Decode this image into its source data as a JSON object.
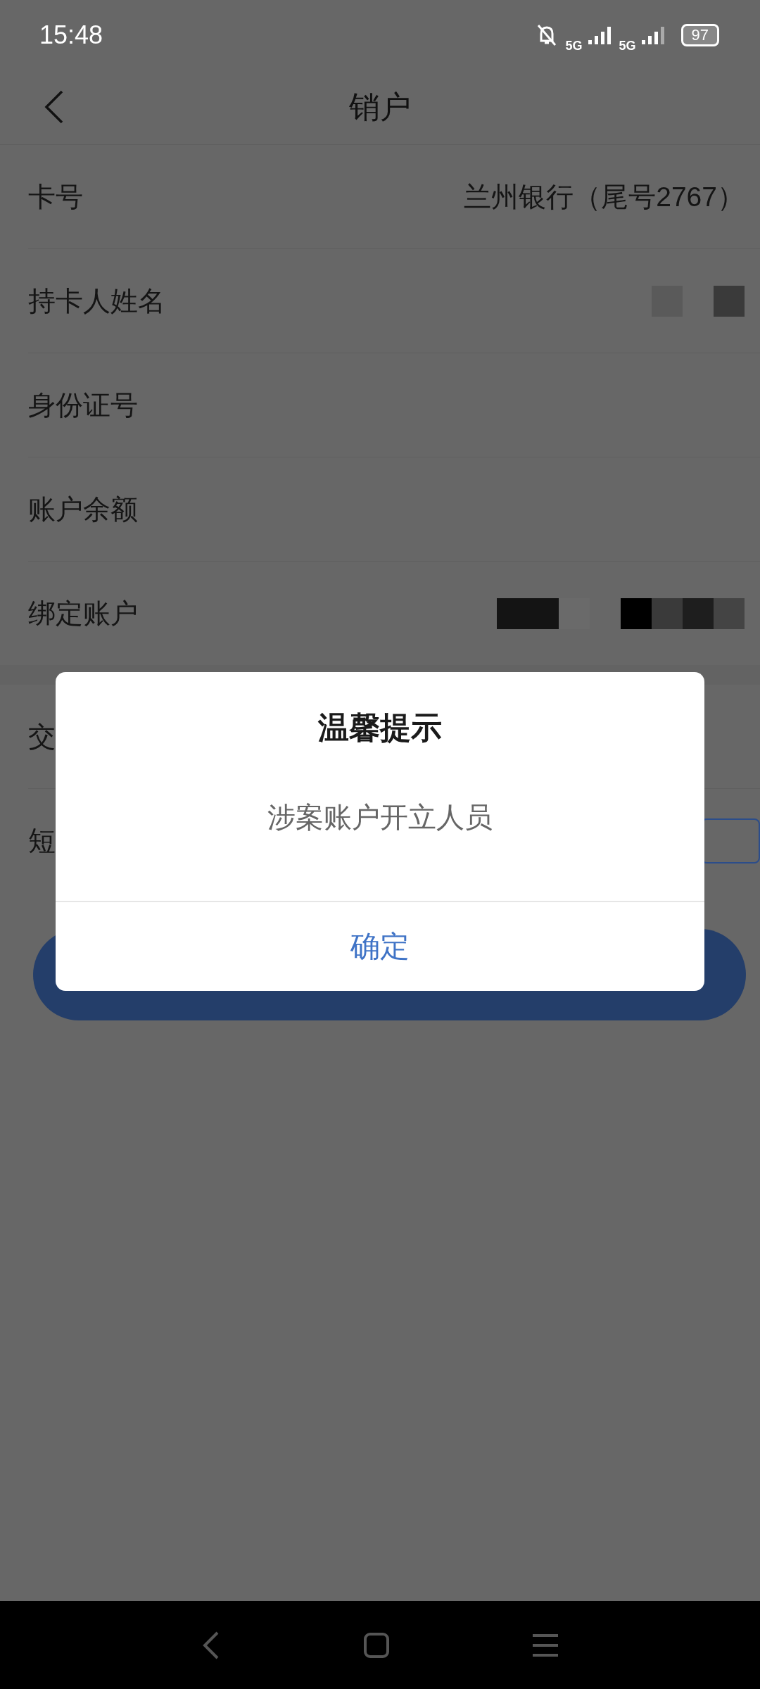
{
  "status_bar": {
    "time": "15:48",
    "battery": "97",
    "network_1": "5G",
    "network_2": "5G"
  },
  "header": {
    "title": "销户"
  },
  "rows": [
    {
      "label": "卡号",
      "value": "兰州银行（尾号2767）",
      "kind": "text"
    },
    {
      "label": "持卡人姓名",
      "kind": "mosaic"
    },
    {
      "label": "身份证号",
      "kind": "empty"
    },
    {
      "label": "账户余额",
      "kind": "empty"
    },
    {
      "label": "绑定账户",
      "kind": "mosaic"
    }
  ],
  "rows_2": [
    {
      "label": "交",
      "kind": "empty"
    },
    {
      "label": "短",
      "kind": "input"
    }
  ],
  "dialog": {
    "title": "温馨提示",
    "message": "涉案账户开立人员",
    "button": "确定"
  }
}
